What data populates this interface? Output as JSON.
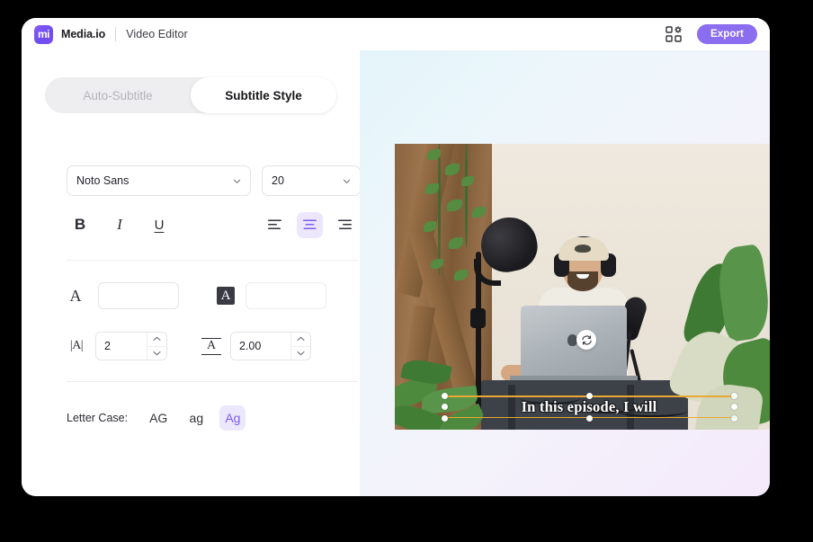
{
  "topbar": {
    "logo_text": "mi",
    "brand": "Media.io",
    "product": "Video Editor",
    "apps_icon": "grid-gear-icon",
    "export_label": "Export",
    "accent_color": "#8b6df0"
  },
  "tabs": [
    {
      "label": "Auto-Subtitle",
      "active": false
    },
    {
      "label": "Subtitle Style",
      "active": true
    }
  ],
  "style_panel": {
    "font_family": {
      "value": "Noto Sans",
      "caret": "chevron-down-icon"
    },
    "font_size": {
      "value": "20",
      "caret": "chevron-down-icon"
    },
    "format_buttons": [
      {
        "name": "bold",
        "label": "B"
      },
      {
        "name": "italic",
        "label": "I"
      },
      {
        "name": "underline",
        "label": "U"
      }
    ],
    "alignment": [
      {
        "name": "align-left",
        "icon": "align-left-icon",
        "selected": false
      },
      {
        "name": "align-center",
        "icon": "align-center-icon",
        "selected": true
      },
      {
        "name": "align-right",
        "icon": "align-right-icon",
        "selected": false
      }
    ],
    "text_color": {
      "icon_glyph": "A",
      "swatch_hex": "#ffffff"
    },
    "background_color": {
      "icon_glyph": "A",
      "swatch_hex": "#ffffff"
    },
    "letter_spacing": {
      "icon_glyph": "|A|",
      "value": "2"
    },
    "line_height": {
      "icon_glyph": "A",
      "value": "2.00"
    },
    "stepper_up_icon": "chevron-up-icon",
    "stepper_down_icon": "chevron-down-icon",
    "letter_case": {
      "label": "Letter Case:",
      "options": [
        {
          "label": "AG",
          "selected": false
        },
        {
          "label": "ag",
          "selected": false
        },
        {
          "label": "Ag",
          "selected": true
        }
      ],
      "selected_color": "#7c5cf0",
      "selected_bg": "#ece7fd"
    }
  },
  "preview": {
    "refresh_icon": "refresh-icon",
    "subtitle_text": "In this episode, I will",
    "selection_border_color": "#e9a934"
  }
}
